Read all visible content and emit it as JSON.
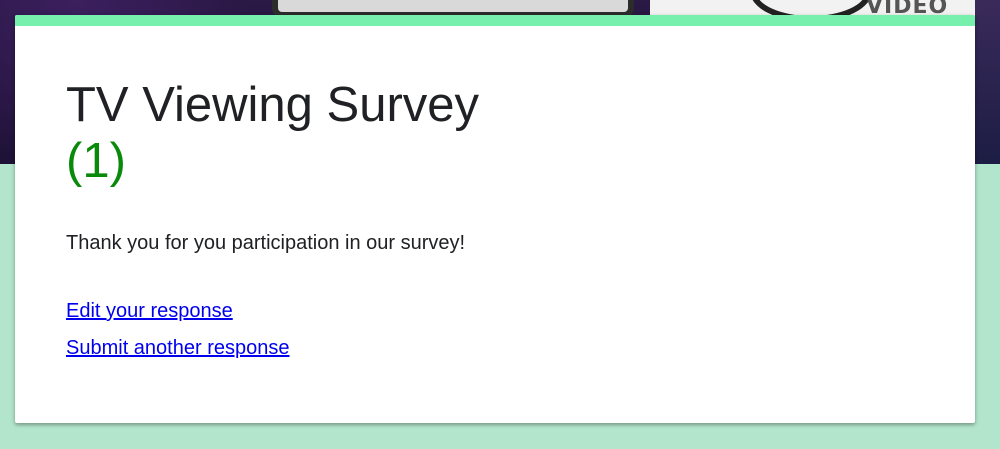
{
  "banner": {
    "logo_text": "VIDEO"
  },
  "form": {
    "title": "TV Viewing Survey",
    "title_count": "(1)",
    "confirmation_message": "Thank you for you participation in our survey!",
    "edit_link_label": "Edit your response",
    "submit_another_label": "Submit another response"
  },
  "colors": {
    "accent": "#78f0ad",
    "page_background": "#b2e5cb",
    "title_count": "#0a8a0a",
    "link": "#0000ee"
  }
}
